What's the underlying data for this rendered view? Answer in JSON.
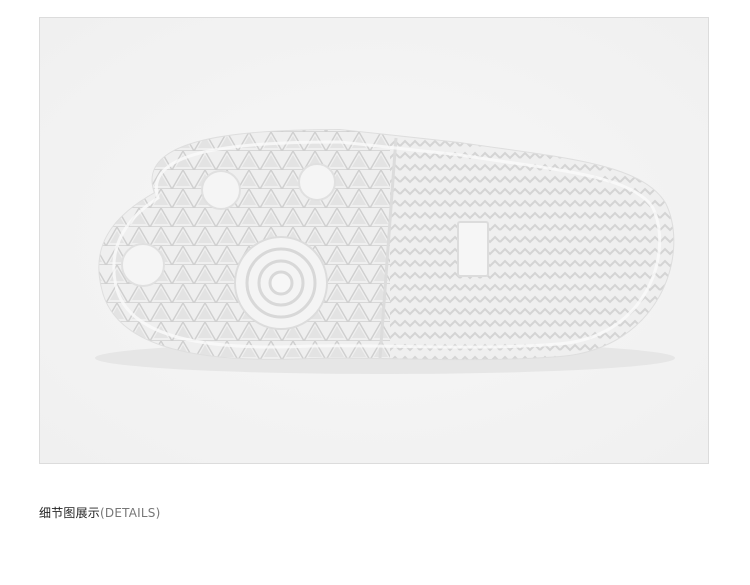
{
  "product_photo": {
    "subject": "shoe-sole"
  },
  "caption": {
    "title_cn": "细节图展示",
    "title_en": "(DETAILS)"
  }
}
